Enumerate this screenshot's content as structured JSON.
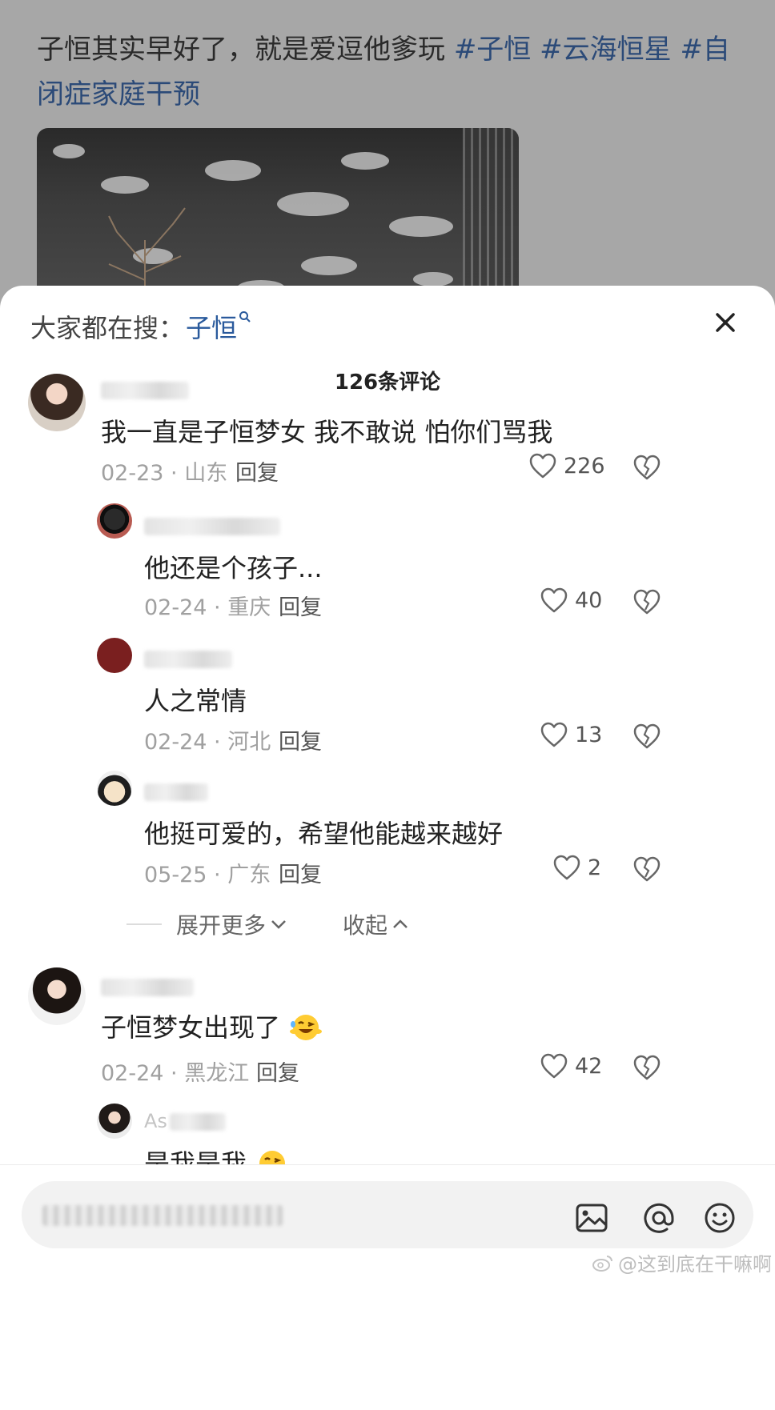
{
  "post": {
    "text": "子恒其实早好了，就是爱逗他爹玩",
    "tags": [
      "#子恒",
      "#云海恒星",
      "#自闭症家庭干预"
    ]
  },
  "sheet": {
    "search_prefix": "大家都在搜：",
    "search_keyword": "子恒",
    "title": "126条评论",
    "expand_label": "展开更多",
    "collapse_label": "收起"
  },
  "comments": [
    {
      "text": "我一直是子恒梦女 我不敢说 怕你们骂我",
      "meta": "02-23 · 山东",
      "reply": "回复",
      "likes": "226"
    },
    {
      "text": "他还是个孩子...",
      "meta": "02-24 · 重庆",
      "reply": "回复",
      "likes": "40"
    },
    {
      "text": "人之常情",
      "meta": "02-24 · 河北",
      "reply": "回复",
      "likes": "13"
    },
    {
      "text": "他挺可爱的，希望他能越来越好",
      "meta": "05-25 · 广东",
      "reply": "回复",
      "likes": "2"
    },
    {
      "text": "子恒梦女出现了",
      "meta": "02-24 · 黑龙江",
      "reply": "回复",
      "likes": "42"
    },
    {
      "text": "是我是我",
      "name_partial": "As"
    }
  ],
  "bottom": {
    "watermark": "@这到底在干嘛啊"
  },
  "icons": [
    "close-icon",
    "search-icon",
    "heart-icon",
    "broken-heart-icon",
    "image-icon",
    "at-icon",
    "emoji-icon",
    "chevron-down-icon",
    "chevron-up-icon",
    "weibo-logo-icon"
  ]
}
